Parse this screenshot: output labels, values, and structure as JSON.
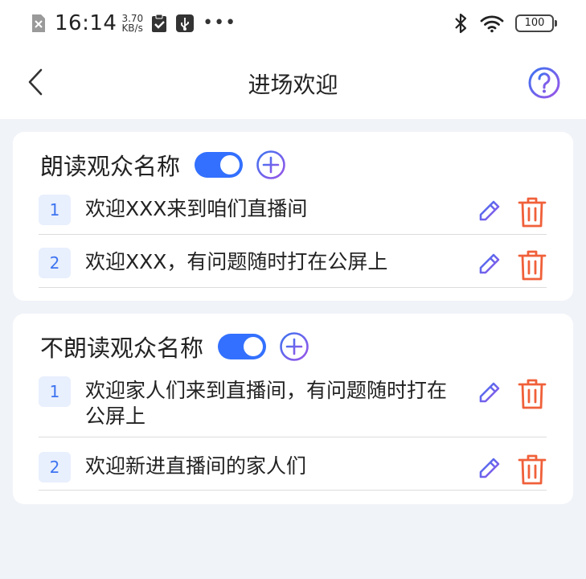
{
  "status_bar": {
    "time": "16:14",
    "speed_value": "3.70",
    "speed_unit": "KB/s",
    "dots": "•••",
    "battery": "100"
  },
  "header": {
    "title": "进场欢迎"
  },
  "sections": [
    {
      "title": "朗读观众名称",
      "toggle_on": true,
      "items": [
        {
          "index": "1",
          "text": "欢迎XXX来到咱们直播间"
        },
        {
          "index": "2",
          "text": "欢迎XXX，有问题随时打在公屏上"
        }
      ]
    },
    {
      "title": "不朗读观众名称",
      "toggle_on": true,
      "items": [
        {
          "index": "1",
          "text": "欢迎家人们来到直播间，有问题随时打在公屏上"
        },
        {
          "index": "2",
          "text": "欢迎新进直播间的家人们"
        }
      ]
    }
  ],
  "colors": {
    "accent": "#3370ff",
    "edit_gradient_start": "#3d74f0",
    "edit_gradient_end": "#9a55e8",
    "delete": "#f0603a",
    "background": "#f0f3f8"
  },
  "icons": {
    "back": "chevron-left-icon",
    "help": "question-circle-icon",
    "add": "plus-circle-icon",
    "edit": "pencil-icon",
    "delete": "trash-icon"
  }
}
